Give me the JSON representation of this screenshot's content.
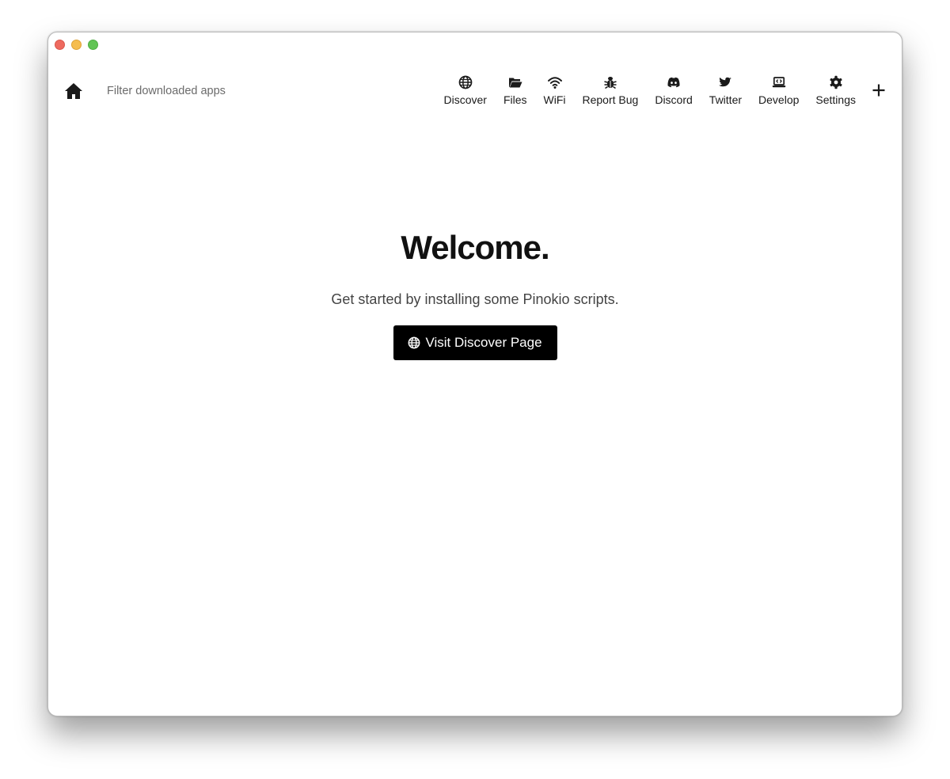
{
  "window": {
    "traffic_lights": {
      "close": "#ee6a5f",
      "minimize": "#f5bd4f",
      "maximize": "#61c454"
    }
  },
  "header": {
    "home_icon": "home-icon",
    "filter_placeholder": "Filter downloaded apps",
    "filter_value": "",
    "nav": [
      {
        "label": "Discover",
        "icon": "globe-icon"
      },
      {
        "label": "Files",
        "icon": "folder-open-icon"
      },
      {
        "label": "WiFi",
        "icon": "wifi-icon"
      },
      {
        "label": "Report Bug",
        "icon": "bug-icon"
      },
      {
        "label": "Discord",
        "icon": "discord-icon"
      },
      {
        "label": "Twitter",
        "icon": "twitter-icon"
      },
      {
        "label": "Develop",
        "icon": "laptop-code-icon"
      },
      {
        "label": "Settings",
        "icon": "gear-icon"
      }
    ],
    "add_icon": "plus-icon"
  },
  "main": {
    "title": "Welcome.",
    "subtitle": "Get started by installing some Pinokio scripts.",
    "cta": {
      "label": "Visit Discover Page",
      "icon": "globe-icon",
      "background": "#000000",
      "color": "#ffffff"
    }
  }
}
